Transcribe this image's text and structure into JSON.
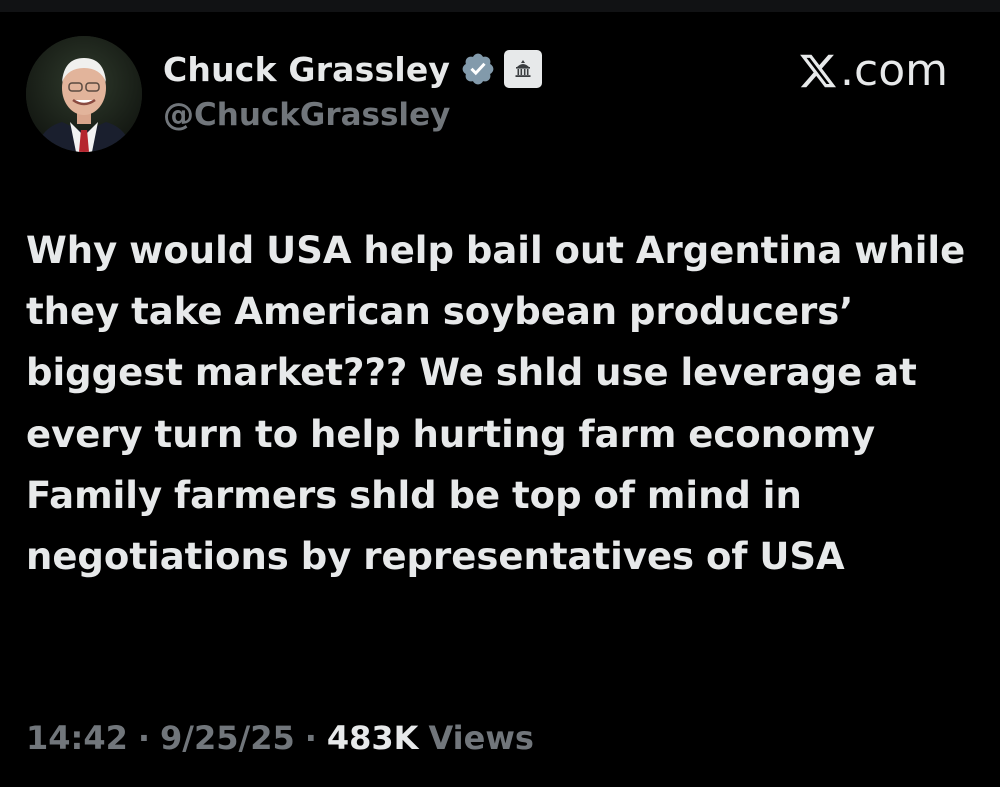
{
  "author": {
    "display_name": "Chuck Grassley",
    "handle": "@ChuckGrassley",
    "badges": [
      "verified-check-icon",
      "government-building-icon"
    ]
  },
  "site": {
    "label": ".com",
    "logo": "x-logo-icon"
  },
  "tweet": {
    "text": "Why would USA help bail out Argentina while they take American soybean producers’ biggest market??? We shld use leverage at every turn to help hurting farm economy Family farmers shld be top of mind in negotiations by representatives of USA"
  },
  "meta": {
    "time": "14:42",
    "separator": "·",
    "date": "9/25/25",
    "views_count": "483K",
    "views_label": "Views"
  },
  "colors": {
    "background": "#000000",
    "primary_text": "#e7e9ea",
    "secondary_text": "#71767b",
    "verified_badge": "#829aab"
  }
}
